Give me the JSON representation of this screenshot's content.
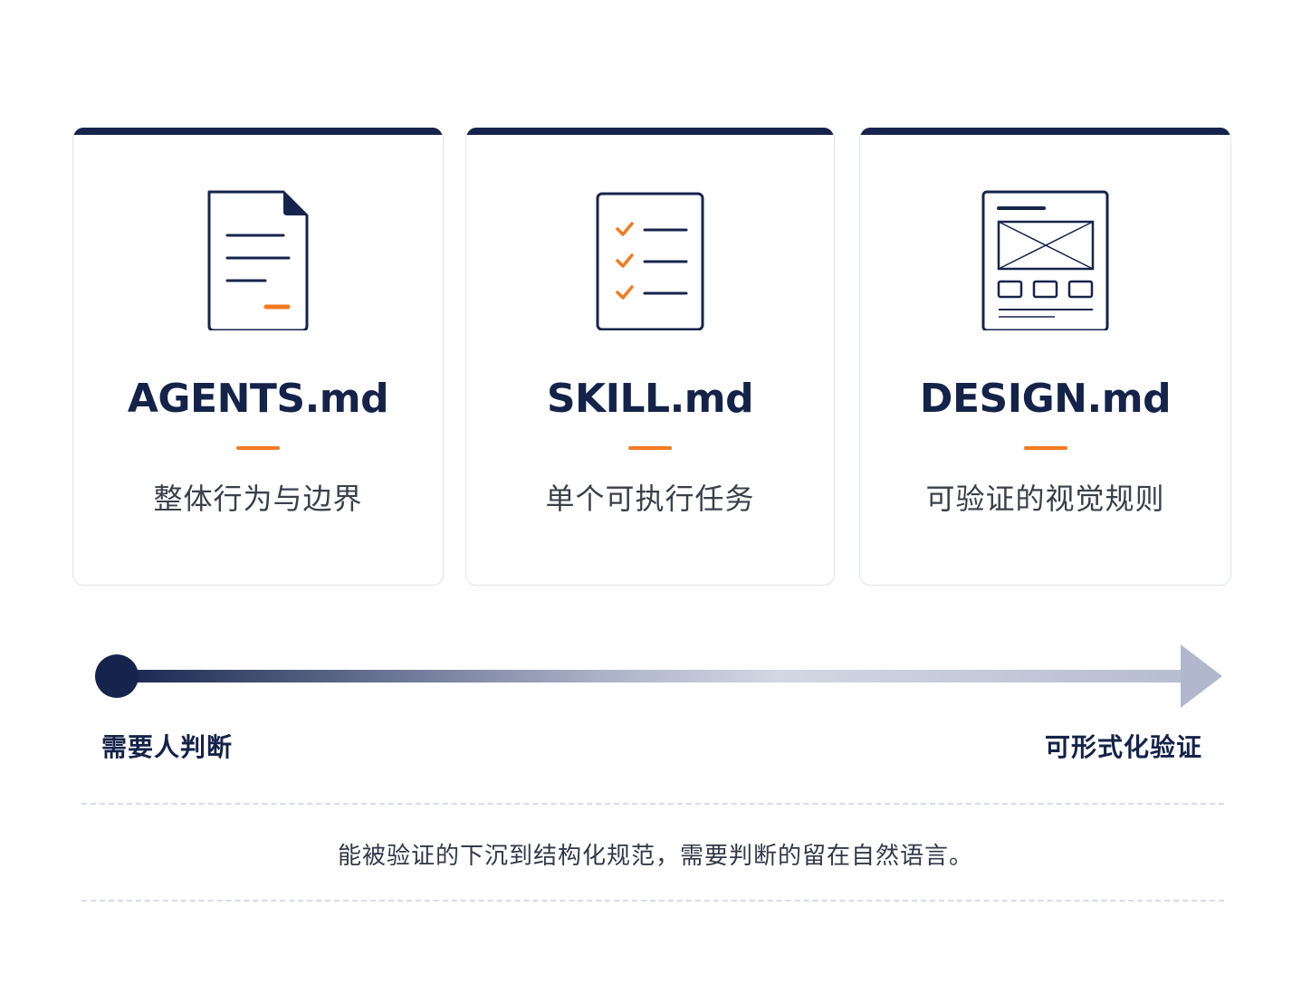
{
  "colors": {
    "navy": "#16244d",
    "accent": "#f47a20",
    "card_border": "#dfe3ea"
  },
  "cards": [
    {
      "title": "AGENTS.md",
      "desc": "整体行为与边界",
      "icon": "document-icon"
    },
    {
      "title": "SKILL.md",
      "desc": "单个可执行任务",
      "icon": "checklist-icon"
    },
    {
      "title": "DESIGN.md",
      "desc": "可验证的视觉规则",
      "icon": "wireframe-icon"
    }
  ],
  "spectrum": {
    "left_label": "需要人判断",
    "right_label": "可形式化验证"
  },
  "summary": "能被验证的下沉到结构化规范，需要判断的留在自然语言。"
}
